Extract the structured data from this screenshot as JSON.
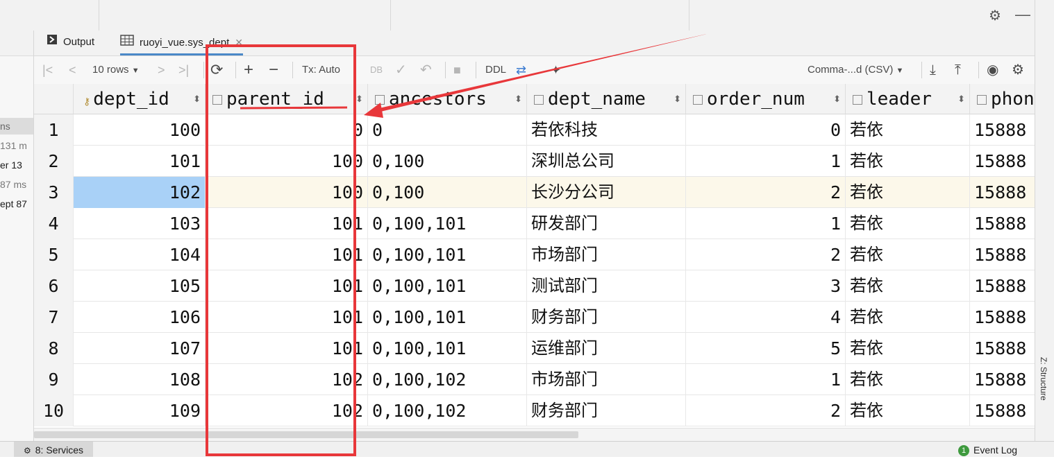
{
  "tabs": {
    "output": "Output",
    "table": "ruoyi_vue.sys_dept"
  },
  "toolbar": {
    "rows": "10 rows",
    "tx": "Tx: Auto",
    "ddl": "DDL",
    "export_format": "Comma-...d (CSV)"
  },
  "left_panel": [
    "ns",
    "131 m",
    "er 13",
    "87 ms",
    "ept 87"
  ],
  "columns": [
    "dept_id",
    "parent_id",
    "ancestors",
    "dept_name",
    "order_num",
    "leader",
    "phon"
  ],
  "rows": [
    [
      "1",
      "100",
      "0",
      "0",
      "若依科技",
      "0",
      "若依",
      "15888"
    ],
    [
      "2",
      "101",
      "100",
      "0,100",
      "深圳总公司",
      "1",
      "若依",
      "15888"
    ],
    [
      "3",
      "102",
      "100",
      "0,100",
      "长沙分公司",
      "2",
      "若依",
      "15888"
    ],
    [
      "4",
      "103",
      "101",
      "0,100,101",
      "研发部门",
      "1",
      "若依",
      "15888"
    ],
    [
      "5",
      "104",
      "101",
      "0,100,101",
      "市场部门",
      "2",
      "若依",
      "15888"
    ],
    [
      "6",
      "105",
      "101",
      "0,100,101",
      "测试部门",
      "3",
      "若依",
      "15888"
    ],
    [
      "7",
      "106",
      "101",
      "0,100,101",
      "财务部门",
      "4",
      "若依",
      "15888"
    ],
    [
      "8",
      "107",
      "101",
      "0,100,101",
      "运维部门",
      "5",
      "若依",
      "15888"
    ],
    [
      "9",
      "108",
      "102",
      "0,100,102",
      "市场部门",
      "1",
      "若依",
      "15888"
    ],
    [
      "10",
      "109",
      "102",
      "0,100,102",
      "财务部门",
      "2",
      "若依",
      "15888"
    ]
  ],
  "selected_row": 3,
  "status": {
    "services": "8: Services",
    "event_log": "Event Log",
    "event_badge": "1"
  },
  "side": {
    "structure": "Z: Structure"
  },
  "annotation_color": "#e8373a"
}
